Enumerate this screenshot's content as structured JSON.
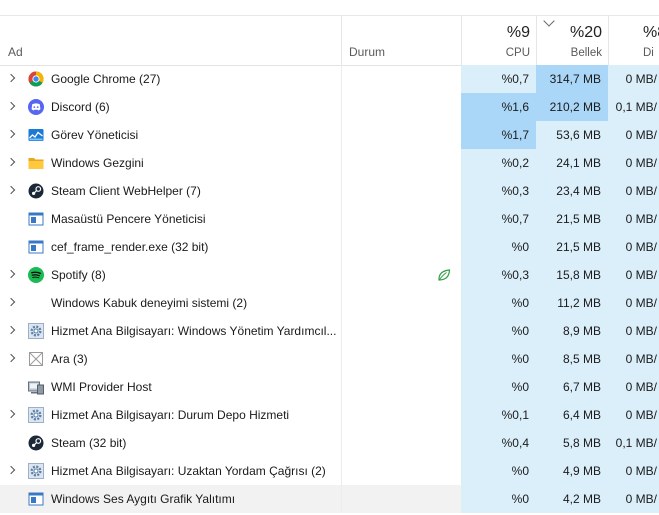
{
  "columns": {
    "name": "Ad",
    "status": "Durum",
    "cpu": {
      "pct": "%9",
      "label": "CPU"
    },
    "memory": {
      "pct": "%20",
      "label": "Bellek"
    },
    "disk": {
      "pct": "%8",
      "label": "Di"
    }
  },
  "colors": {
    "heat_light": "#dbeffb",
    "heat_medium": "#c6e6fa",
    "heat_strong": "#aad7f8",
    "header_border": "#e5e5e5",
    "selected_row": "#f2f2f2"
  },
  "processes": [
    {
      "name": "Google Chrome (27)",
      "expandable": true,
      "icon": "chrome-icon",
      "status": "",
      "cpu": "%0,7",
      "memory": "314,7 MB",
      "disk": "0 MB/",
      "cpu_heat": "light",
      "mem_heat": "strong",
      "disk_heat": "light"
    },
    {
      "name": "Discord (6)",
      "expandable": true,
      "icon": "discord-icon",
      "status": "",
      "cpu": "%1,6",
      "memory": "210,2 MB",
      "disk": "0,1 MB/",
      "cpu_heat": "strong",
      "mem_heat": "strong",
      "disk_heat": "light"
    },
    {
      "name": "Görev Yöneticisi",
      "expandable": true,
      "icon": "task-manager-icon",
      "status": "",
      "cpu": "%1,7",
      "memory": "53,6 MB",
      "disk": "0 MB/",
      "cpu_heat": "strong",
      "mem_heat": "light",
      "disk_heat": "light"
    },
    {
      "name": "Windows Gezgini",
      "expandable": true,
      "icon": "folder-icon",
      "status": "",
      "cpu": "%0,2",
      "memory": "24,1 MB",
      "disk": "0 MB/",
      "cpu_heat": "light",
      "mem_heat": "light",
      "disk_heat": "light"
    },
    {
      "name": "Steam Client WebHelper (7)",
      "expandable": true,
      "icon": "steam-icon",
      "status": "",
      "cpu": "%0,3",
      "memory": "23,4 MB",
      "disk": "0 MB/",
      "cpu_heat": "light",
      "mem_heat": "light",
      "disk_heat": "light"
    },
    {
      "name": "Masaüstü Pencere Yöneticisi",
      "expandable": false,
      "icon": "window-app-icon",
      "status": "",
      "cpu": "%0,7",
      "memory": "21,5 MB",
      "disk": "0 MB/",
      "cpu_heat": "light",
      "mem_heat": "light",
      "disk_heat": "light"
    },
    {
      "name": "cef_frame_render.exe (32 bit)",
      "expandable": false,
      "icon": "window-app-icon",
      "status": "",
      "cpu": "%0",
      "memory": "21,5 MB",
      "disk": "0 MB/",
      "cpu_heat": "light",
      "mem_heat": "light",
      "disk_heat": "light"
    },
    {
      "name": "Spotify (8)",
      "expandable": true,
      "icon": "spotify-icon",
      "status": "eco-leaf-icon",
      "cpu": "%0,3",
      "memory": "15,8 MB",
      "disk": "0 MB/",
      "cpu_heat": "light",
      "mem_heat": "light",
      "disk_heat": "light"
    },
    {
      "name": "Windows Kabuk deneyimi sistemi (2)",
      "expandable": true,
      "icon": "none",
      "status": "",
      "cpu": "%0",
      "memory": "11,2 MB",
      "disk": "0 MB/",
      "cpu_heat": "light",
      "mem_heat": "light",
      "disk_heat": "light"
    },
    {
      "name": "Hizmet Ana Bilgisayarı: Windows Yönetim Yardımcıl...",
      "expandable": true,
      "icon": "service-gear-icon",
      "status": "",
      "cpu": "%0",
      "memory": "8,9 MB",
      "disk": "0 MB/",
      "cpu_heat": "light",
      "mem_heat": "light",
      "disk_heat": "light"
    },
    {
      "name": "Ara (3)",
      "expandable": true,
      "icon": "search-placeholder-icon",
      "status": "",
      "cpu": "%0",
      "memory": "8,5 MB",
      "disk": "0 MB/",
      "cpu_heat": "light",
      "mem_heat": "light",
      "disk_heat": "light"
    },
    {
      "name": "WMI Provider Host",
      "expandable": false,
      "icon": "wmi-icon",
      "status": "",
      "cpu": "%0",
      "memory": "6,7 MB",
      "disk": "0 MB/",
      "cpu_heat": "light",
      "mem_heat": "light",
      "disk_heat": "light"
    },
    {
      "name": "Hizmet Ana Bilgisayarı: Durum Depo Hizmeti",
      "expandable": true,
      "icon": "service-gear-icon",
      "status": "",
      "cpu": "%0,1",
      "memory": "6,4 MB",
      "disk": "0 MB/",
      "cpu_heat": "light",
      "mem_heat": "light",
      "disk_heat": "light"
    },
    {
      "name": "Steam (32 bit)",
      "expandable": false,
      "icon": "steam-icon",
      "status": "",
      "cpu": "%0,4",
      "memory": "5,8 MB",
      "disk": "0,1 MB/",
      "cpu_heat": "light",
      "mem_heat": "light",
      "disk_heat": "light"
    },
    {
      "name": "Hizmet Ana Bilgisayarı: Uzaktan Yordam Çağrısı (2)",
      "expandable": true,
      "icon": "service-gear-icon",
      "status": "",
      "cpu": "%0",
      "memory": "4,9 MB",
      "disk": "0 MB/",
      "cpu_heat": "light",
      "mem_heat": "light",
      "disk_heat": "light"
    },
    {
      "name": "Windows Ses Aygıtı Grafik Yalıtımı",
      "expandable": false,
      "icon": "window-app-icon",
      "status": "",
      "cpu": "%0",
      "memory": "4,2 MB",
      "disk": "0 MB/",
      "cpu_heat": "light",
      "mem_heat": "light",
      "disk_heat": "light",
      "selected": true
    }
  ]
}
